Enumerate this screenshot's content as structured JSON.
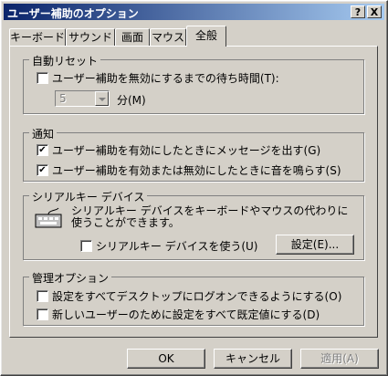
{
  "window": {
    "title": "ユーザー補助のオプション",
    "help_glyph": "?",
    "close_glyph": "X"
  },
  "tabs": [
    {
      "label": "キーボード"
    },
    {
      "label": "サウンド"
    },
    {
      "label": "画面"
    },
    {
      "label": "マウス"
    },
    {
      "label": "全般",
      "active": true
    }
  ],
  "auto_reset": {
    "group_label": "自動リセット",
    "checkbox_label": "ユーザー補助を無効にするまでの待ち時間(T):",
    "checked": false,
    "minutes_value": "5",
    "minutes_unit": "分(M)"
  },
  "notification": {
    "group_label": "通知",
    "items": [
      {
        "label": "ユーザー補助を有効にしたときにメッセージを出す(G)",
        "checked": true
      },
      {
        "label": "ユーザー補助を有効または無効にしたときに音を鳴らす(S)",
        "checked": true
      }
    ]
  },
  "serialkeys": {
    "group_label": "シリアルキー デバイス",
    "description": "シリアルキー デバイスをキーボードやマウスの代わりに使うことができます。",
    "checkbox_label": "シリアルキー デバイスを使う(U)",
    "checked": false,
    "settings_button": "設定(E)..."
  },
  "admin": {
    "group_label": "管理オプション",
    "items": [
      {
        "label": "設定をすべてデスクトップにログオンできるようにする(O)",
        "checked": false
      },
      {
        "label": "新しいユーザーのために設定をすべて既定値にする(D)",
        "checked": false
      }
    ]
  },
  "footer": {
    "ok": "OK",
    "cancel": "キャンセル",
    "apply": "適用(A)"
  },
  "check_glyph": "✔"
}
